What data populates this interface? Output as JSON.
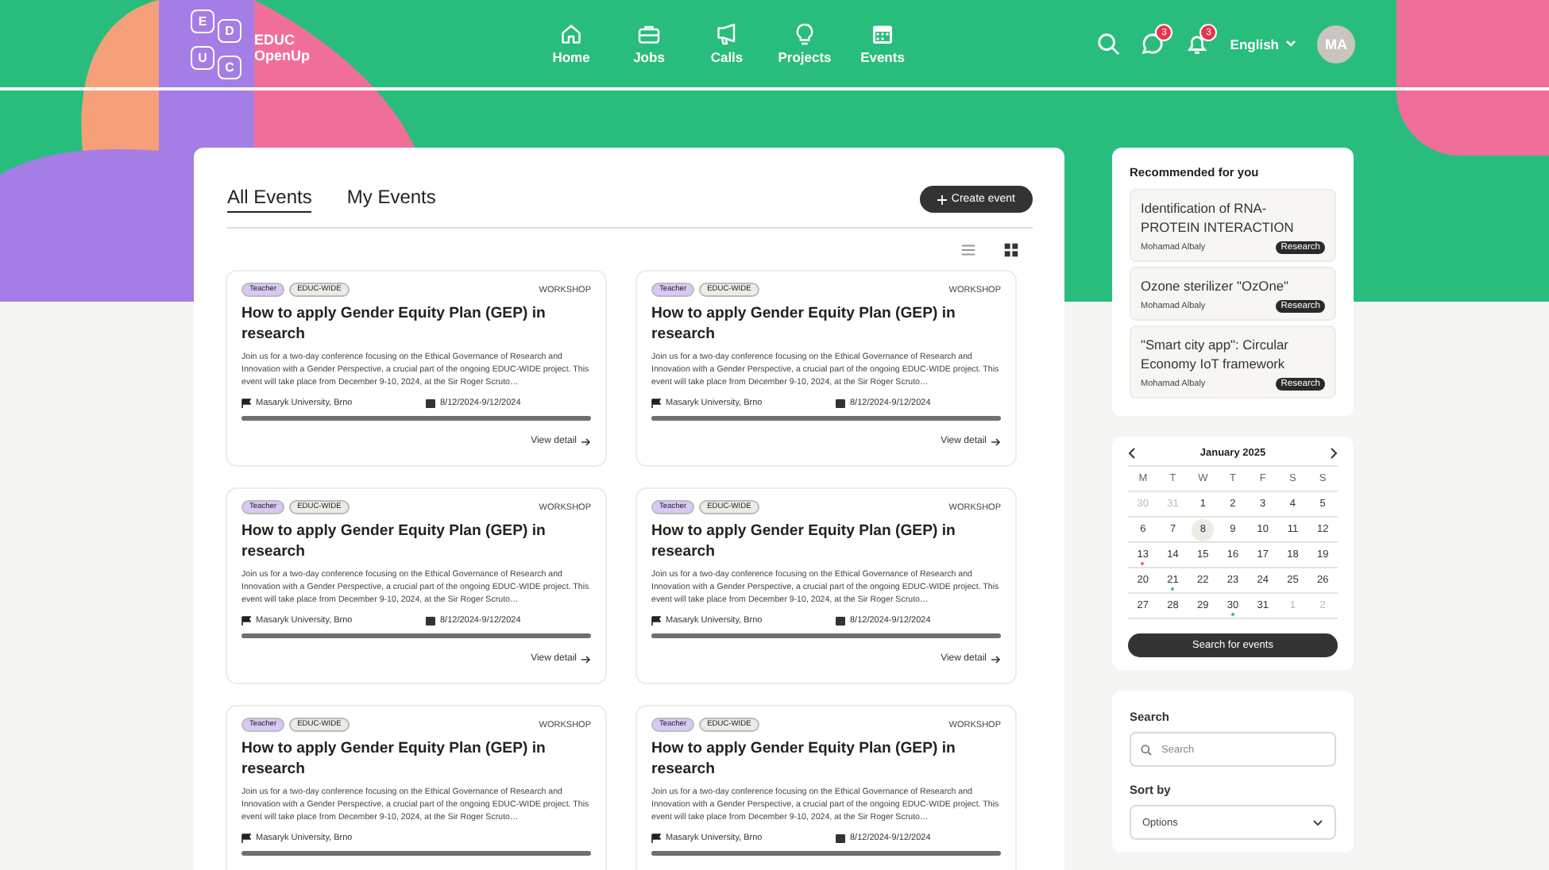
{
  "header": {
    "logo_letters": [
      "E",
      "D",
      "U",
      "C"
    ],
    "brand_lines": [
      "EDUC",
      "OpenUp"
    ],
    "nav": [
      {
        "label": "Home"
      },
      {
        "label": "Jobs"
      },
      {
        "label": "Calls"
      },
      {
        "label": "Projects"
      },
      {
        "label": "Events"
      }
    ],
    "messages_badge": "3",
    "notifications_badge": "3",
    "language": "English",
    "avatar": "MA"
  },
  "events": {
    "tabs": [
      {
        "label": "All Events",
        "selected": true
      },
      {
        "label": "My Events",
        "selected": false
      }
    ],
    "create_button": "Create event",
    "views": [
      {
        "selected": false
      },
      {
        "selected": true
      }
    ],
    "cards": [
      {
        "tags": [
          {
            "label": "Teacher",
            "color": "#d9c8f5"
          },
          {
            "label": "EDUC-WIDE",
            "color": "#ecebe5"
          }
        ],
        "type": "WORKSHOP",
        "title": "How to apply Gender Equity Plan (GEP) in research",
        "description": "Join us for a two-day conference focusing on the Ethical Governance of Research and Innovation with a Gender Perspective, a crucial part of the ongoing EDUC-WIDE project. This event will take place from December 9-10, 2024, at the Sir Roger Scruto…",
        "location": "Masaryk University, Brno",
        "date": "8/12/2024-9/12/2024",
        "link": "View detail"
      },
      {
        "tags": [
          {
            "label": "Teacher",
            "color": "#d9c8f5"
          },
          {
            "label": "EDUC-WIDE",
            "color": "#ecebe5"
          }
        ],
        "type": "WORKSHOP",
        "title": "How to apply Gender Equity Plan (GEP) in research",
        "description": "Join us for a two-day conference focusing on the Ethical Governance of Research and Innovation with a Gender Perspective, a crucial part of the ongoing EDUC-WIDE project. This event will take place from December 9-10, 2024, at the Sir Roger Scruto…",
        "location": "Masaryk University, Brno",
        "date": "8/12/2024-9/12/2024",
        "link": "View detail"
      },
      {
        "tags": [
          {
            "label": "Teacher",
            "color": "#d9c8f5"
          },
          {
            "label": "EDUC-WIDE",
            "color": "#ecebe5"
          }
        ],
        "type": "WORKSHOP",
        "title": "How to apply Gender Equity Plan (GEP) in research",
        "description": "Join us for a two-day conference focusing on the Ethical Governance of Research and Innovation with a Gender Perspective, a crucial part of the ongoing EDUC-WIDE project. This event will take place from December 9-10, 2024, at the Sir Roger Scruto…",
        "location": "Masaryk University, Brno",
        "date": "8/12/2024-9/12/2024",
        "link": "View detail"
      },
      {
        "tags": [
          {
            "label": "Teacher",
            "color": "#d9c8f5"
          },
          {
            "label": "EDUC-WIDE",
            "color": "#ecebe5"
          }
        ],
        "type": "WORKSHOP",
        "title": "How to apply Gender Equity Plan (GEP) in research",
        "description": "Join us for a two-day conference focusing on the Ethical Governance of Research and Innovation with a Gender Perspective, a crucial part of the ongoing EDUC-WIDE project. This event will take place from December 9-10, 2024, at the Sir Roger Scruto…",
        "location": "Masaryk University, Brno",
        "date": "8/12/2024-9/12/2024",
        "link": "View detail"
      },
      {
        "tags": [
          {
            "label": "Teacher",
            "color": "#d9c8f5"
          },
          {
            "label": "EDUC-WIDE",
            "color": "#ecebe5"
          }
        ],
        "type": "WORKSHOP",
        "title": "How to apply Gender Equity Plan (GEP) in research",
        "description": "Join us for a two-day conference focusing on the Ethical Governance of Research and Innovation with a Gender Perspective, a crucial part of the ongoing EDUC-WIDE project. This event will take place from December 9-10, 2024, at the Sir Roger Scruto…",
        "location": "Masaryk University, Brno"
      },
      {
        "tags": [
          {
            "label": "Teacher",
            "color": "#d9c8f5"
          },
          {
            "label": "EDUC-WIDE",
            "color": "#ecebe5"
          }
        ],
        "type": "WORKSHOP",
        "title": "How to apply Gender Equity Plan (GEP) in research",
        "description": "Join us for a two-day conference focusing on the Ethical Governance of Research and Innovation with a Gender Perspective, a crucial part of the ongoing EDUC-WIDE project. This event will take place from December 9-10, 2024, at the Sir Roger Scruto…",
        "location": "Masaryk University, Brno",
        "date": "8/12/2024-9/12/2024"
      }
    ]
  },
  "recommended": {
    "title": "Recommended for you",
    "items": [
      {
        "title": "Identification of RNA-PROTEIN INTERACTION",
        "author": "Mohamad Albaly",
        "tag": "Research"
      },
      {
        "title": "Ozone sterilizer \"OzOne\"",
        "author": "Mohamad Albaly",
        "tag": "Research"
      },
      {
        "title": "\"Smart city app\": Circular Economy IoT framework",
        "author": "Mohamad Albaly",
        "tag": "Research"
      }
    ]
  },
  "calendar": {
    "month": "January 2025",
    "weekdays": [
      "M",
      "T",
      "W",
      "T",
      "F",
      "S",
      "S"
    ],
    "days": [
      {
        "label": "30",
        "muted": true,
        "selected": false
      },
      {
        "label": "31",
        "muted": true,
        "selected": false
      },
      {
        "label": "1",
        "muted": false,
        "selected": false
      },
      {
        "label": "2",
        "muted": false,
        "selected": false
      },
      {
        "label": "3",
        "muted": false,
        "selected": false
      },
      {
        "label": "4",
        "muted": false,
        "selected": false
      },
      {
        "label": "5",
        "muted": false,
        "selected": false
      },
      {
        "label": "6",
        "muted": false,
        "selected": false
      },
      {
        "label": "7",
        "muted": false,
        "selected": false
      },
      {
        "label": "8",
        "muted": false,
        "selected": true
      },
      {
        "label": "9",
        "muted": false,
        "selected": false
      },
      {
        "label": "10",
        "muted": false,
        "selected": false
      },
      {
        "label": "11",
        "muted": false,
        "selected": false
      },
      {
        "label": "12",
        "muted": false,
        "selected": false
      },
      {
        "label": "13",
        "muted": false,
        "selected": false,
        "color": "#f0528a"
      },
      {
        "label": "14",
        "muted": false,
        "selected": false
      },
      {
        "label": "15",
        "muted": false,
        "selected": false
      },
      {
        "label": "16",
        "muted": false,
        "selected": false
      },
      {
        "label": "17",
        "muted": false,
        "selected": false
      },
      {
        "label": "18",
        "muted": false,
        "selected": false
      },
      {
        "label": "19",
        "muted": false,
        "selected": false
      },
      {
        "label": "20",
        "muted": false,
        "selected": false
      },
      {
        "label": "21",
        "muted": false,
        "selected": false,
        "color": "#2dbf7c"
      },
      {
        "label": "22",
        "muted": false,
        "selected": false
      },
      {
        "label": "23",
        "muted": false,
        "selected": false
      },
      {
        "label": "24",
        "muted": false,
        "selected": false
      },
      {
        "label": "25",
        "muted": false,
        "selected": false
      },
      {
        "label": "26",
        "muted": false,
        "selected": false
      },
      {
        "label": "27",
        "muted": false,
        "selected": false
      },
      {
        "label": "28",
        "muted": false,
        "selected": false
      },
      {
        "label": "29",
        "muted": false,
        "selected": false
      },
      {
        "label": "30",
        "muted": false,
        "selected": false,
        "color": "#2dbf7c"
      },
      {
        "label": "31",
        "muted": false,
        "selected": false
      },
      {
        "label": "1",
        "muted": true,
        "selected": false
      },
      {
        "label": "2",
        "muted": true,
        "selected": false
      }
    ],
    "button": "Search for events"
  },
  "filters": {
    "search_label": "Search",
    "search_placeholder": "Search",
    "sort_label": "Sort by",
    "sort_value": "Options"
  }
}
